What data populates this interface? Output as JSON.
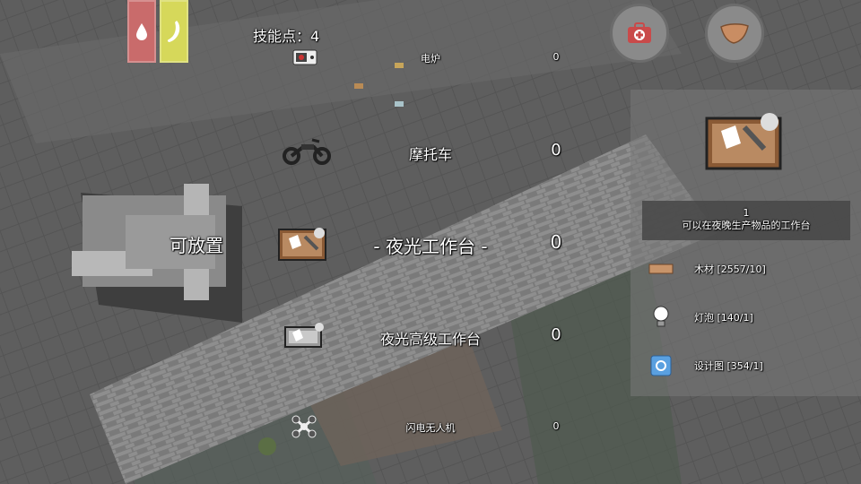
{
  "skill_points": "技能点：4",
  "place_label": "可放置",
  "items": [
    {
      "name": "电炉",
      "count": "0",
      "icon": "electric-stove-icon"
    },
    {
      "name": "摩托车",
      "count": "0",
      "icon": "motorcycle-icon"
    },
    {
      "name": "- 夜光工作台 -",
      "count": "0",
      "icon": "glow-workbench-icon"
    },
    {
      "name": "夜光高级工作台",
      "count": "0",
      "icon": "advanced-glow-workbench-icon"
    },
    {
      "name": "闪电无人机",
      "count": "0",
      "icon": "lightning-drone-icon"
    }
  ],
  "detail": {
    "count": "1",
    "description": "可以在夜晚生产物品的工作台",
    "materials": [
      {
        "label": "木材 [2557/10]",
        "icon": "wood-plank-icon"
      },
      {
        "label": "灯泡 [140/1]",
        "icon": "light-bulb-icon"
      },
      {
        "label": "设计图 [354/1]",
        "icon": "blueprint-icon"
      }
    ]
  },
  "buttons": {
    "medkit": "medkit-icon",
    "inventory": "leather-bag-icon"
  },
  "colors": {
    "thirst_bar": "#c96b6b",
    "hunger_bar": "#d6d85a",
    "panel": "#787878"
  }
}
